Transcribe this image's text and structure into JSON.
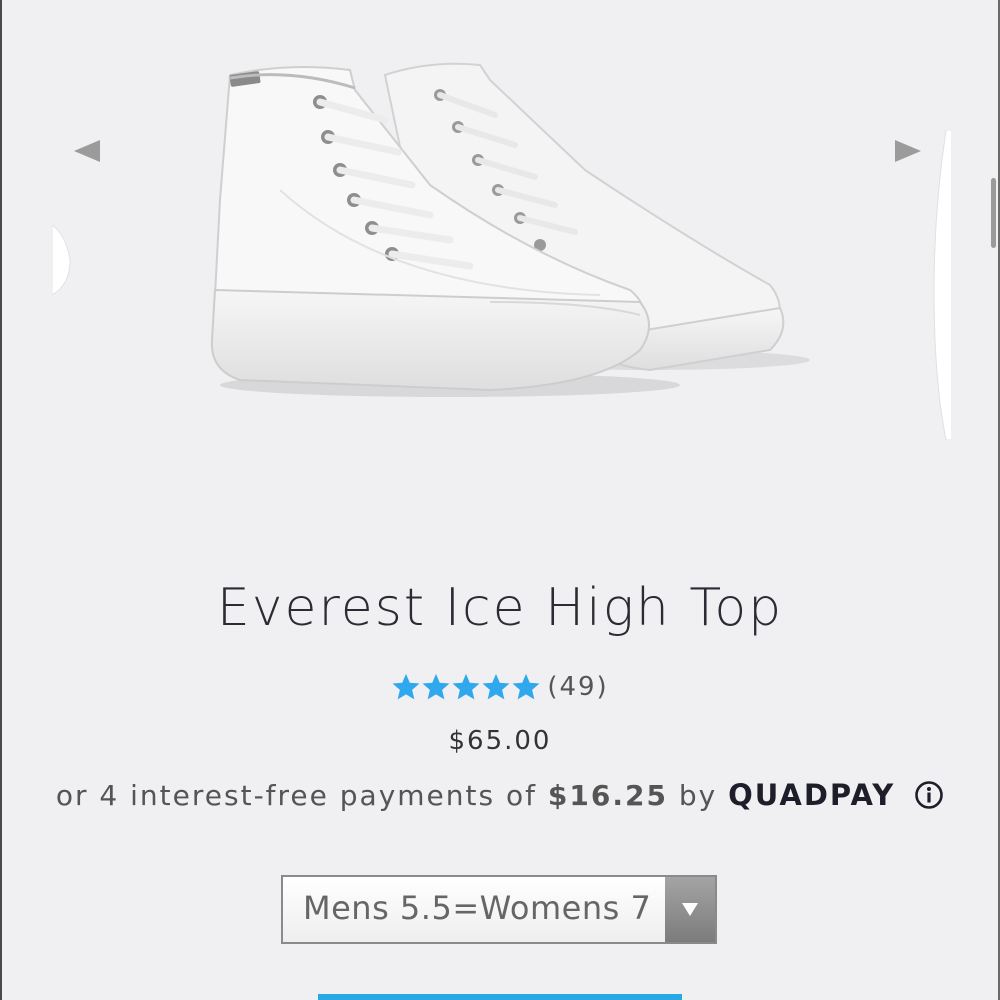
{
  "product": {
    "title": "Everest Ice High Top",
    "rating": {
      "stars": 5,
      "max": 5,
      "count_label": "(49)"
    },
    "price": "$65.00"
  },
  "installments": {
    "prefix": "or 4 interest-free payments of",
    "amount": "$16.25",
    "by": "by",
    "brand": "QUADPAY"
  },
  "size_select": {
    "selected": "Mens 5.5=Womens 7"
  },
  "icons": {
    "prev": "triangle-left-icon",
    "next": "triangle-right-icon",
    "star": "star-icon",
    "info": "info-circle-icon",
    "dropdown": "caret-down-icon"
  },
  "colors": {
    "star": "#2fa8ee",
    "cta": "#29a8e6",
    "background": "#f0f0f2",
    "title": "#2b2b33"
  }
}
